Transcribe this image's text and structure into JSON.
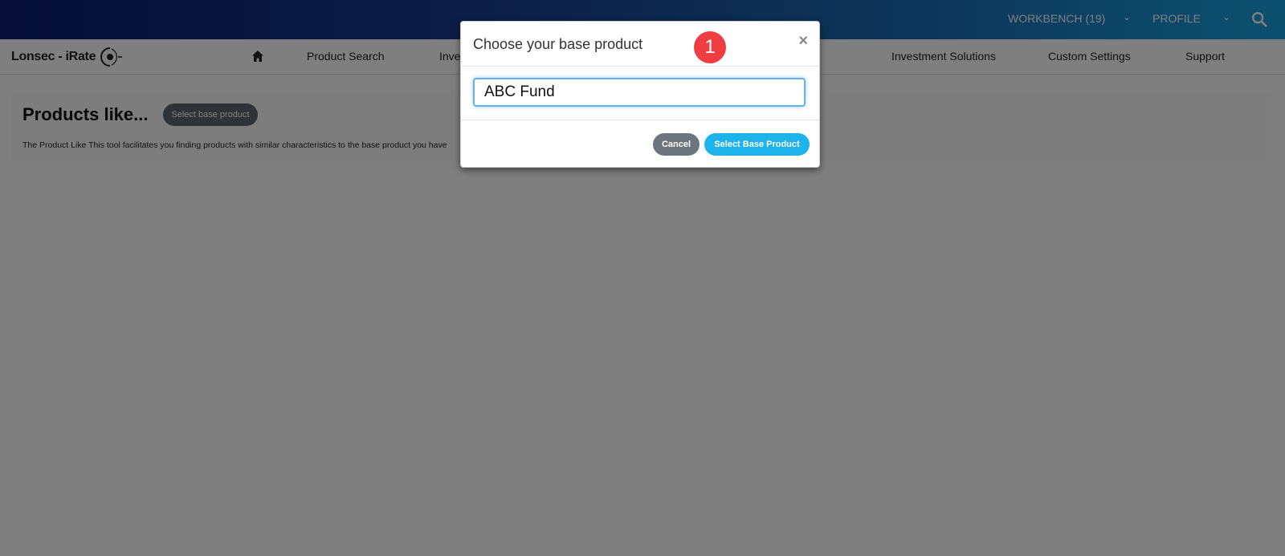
{
  "topbar": {
    "workbench_label": "WORKBENCH (19)",
    "profile_label": "PROFILE",
    "chevron": "⌄"
  },
  "navbar": {
    "logo_text_1": "Lonsec",
    "logo_text_2": " - iRate",
    "items": [
      {
        "label": "Product Search"
      },
      {
        "label": "Inves"
      },
      {
        "label": "Investment Solutions"
      },
      {
        "label": "Custom Settings"
      },
      {
        "label": "Support"
      }
    ]
  },
  "page": {
    "title": "Products like...",
    "select_base_button": "Select base product",
    "description": "The Product Like This tool facilitates you finding products with similar characteristics to the base product you have"
  },
  "modal": {
    "title": "Choose your base product",
    "close_symbol": "×",
    "step_badge": "1",
    "input_value": "ABC Fund",
    "cancel_label": "Cancel",
    "confirm_label": "Select Base Product"
  },
  "colors": {
    "accent": "#1fb3ec",
    "badge": "#ef3e42",
    "cancel": "#6c757d"
  }
}
